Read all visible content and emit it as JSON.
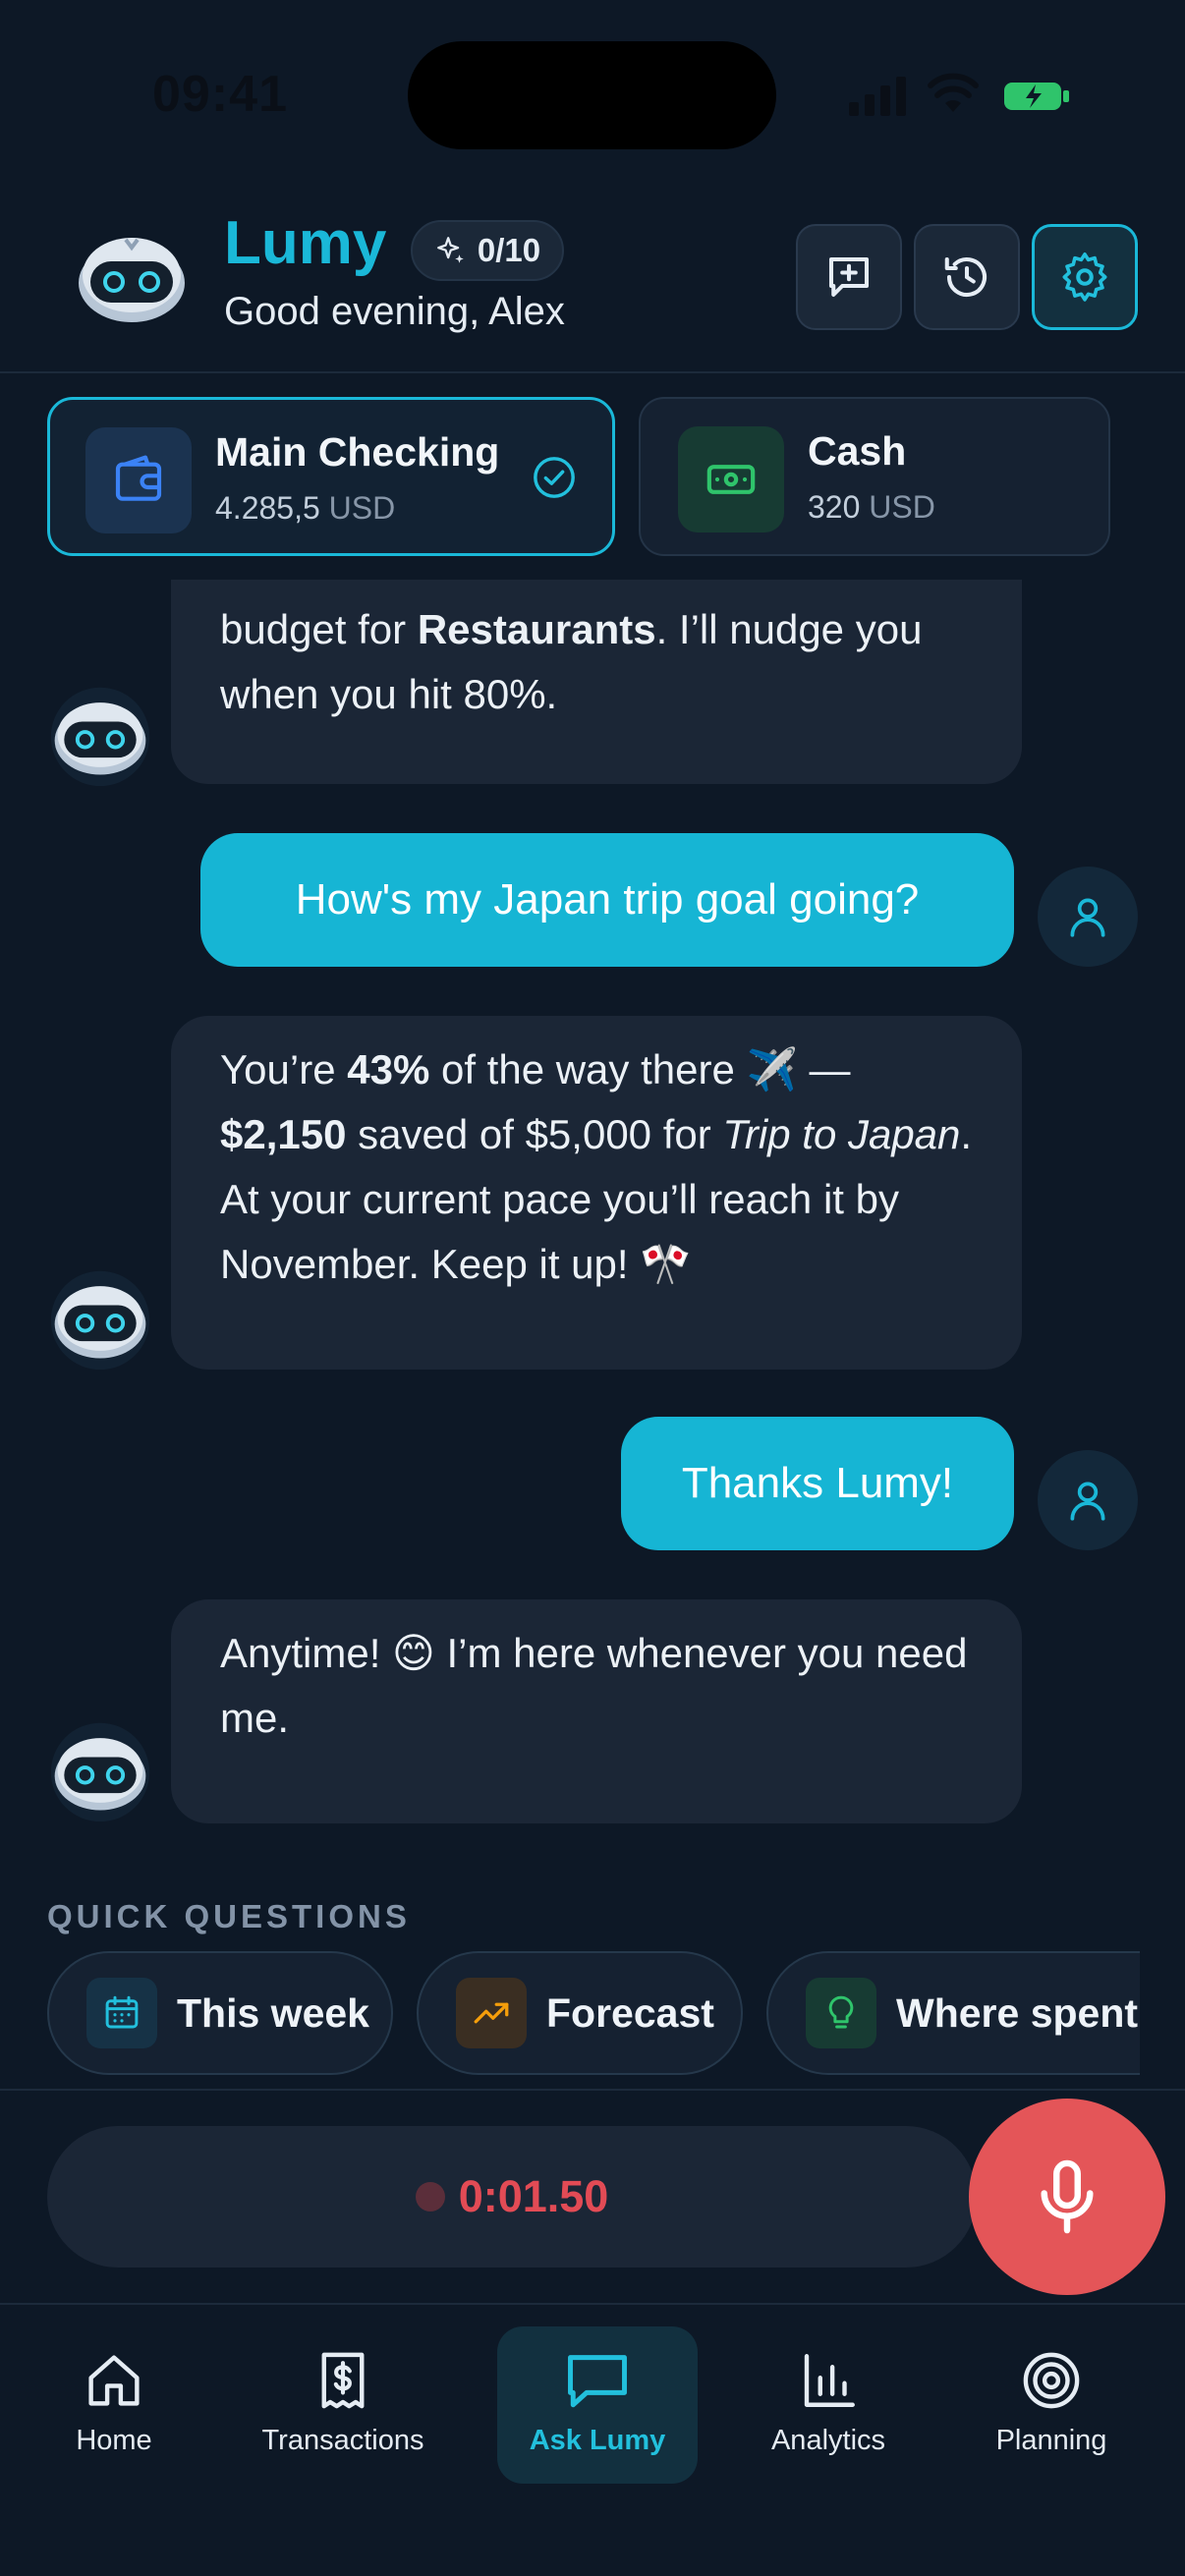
{
  "status": {
    "time": "09:41"
  },
  "header": {
    "app_name": "Lumy",
    "badge": "0/10",
    "greeting": "Good evening, Alex",
    "buttons": [
      "new-chat-icon",
      "history-icon",
      "settings-icon"
    ]
  },
  "accounts": [
    {
      "name": "Main Checking",
      "amount": "4.285,5",
      "currency": "USD",
      "selected": true
    },
    {
      "name": "Cash",
      "amount": "320",
      "currency": "USD",
      "selected": false
    }
  ],
  "chat": {
    "m1_partial_top": "budget for ",
    "m1_bold": "Restaurants",
    "m1_rest": ". I’ll nudge you when you hit 80%.",
    "u1": "How's my Japan trip goal going?",
    "m2_a": "You’re ",
    "m2_b": "43%",
    "m2_c": " of the way there ✈️ — ",
    "m2_d": "$2,150",
    "m2_e": " saved of $5,000 for ",
    "m2_f": "Trip to Japan",
    "m2_g": ". At your current pace you’ll reach it by November. Keep it up! 🎌",
    "u2": "Thanks Lumy!",
    "m3": "Anytime! 😊 I’m here whenever you need me."
  },
  "quick_questions": {
    "title": "QUICK QUESTIONS",
    "items": [
      "This week",
      "Forecast",
      "Where spent"
    ]
  },
  "recorder": {
    "time": "0:01.50"
  },
  "tabs": [
    {
      "label": "Home",
      "icon": "home-icon"
    },
    {
      "label": "Transactions",
      "icon": "receipt-icon"
    },
    {
      "label": "Ask Lumy",
      "icon": "chat-icon",
      "active": true
    },
    {
      "label": "Analytics",
      "icon": "bar-chart-icon"
    },
    {
      "label": "Planning",
      "icon": "target-icon"
    }
  ],
  "colors": {
    "accent": "#1ab8d8",
    "background": "#0d1826",
    "record": "#e45558"
  }
}
